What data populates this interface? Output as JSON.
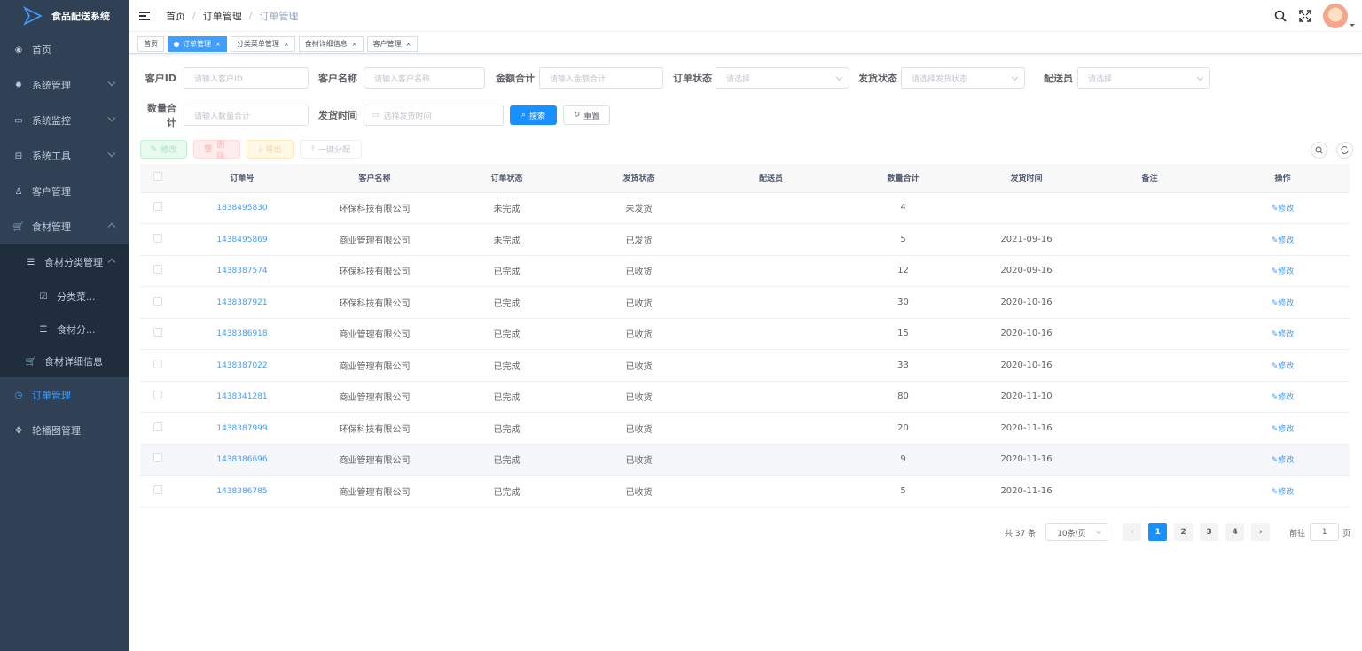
{
  "app": {
    "title": "食品配送系统"
  },
  "sidebar": {
    "items": [
      {
        "label": "首页",
        "icon": "dashboard-icon"
      },
      {
        "label": "系统管理",
        "icon": "gear-icon"
      },
      {
        "label": "系统监控",
        "icon": "monitor-icon"
      },
      {
        "label": "系统工具",
        "icon": "toolbox-icon"
      },
      {
        "label": "客户管理",
        "icon": "user-icon"
      },
      {
        "label": "食材管理",
        "icon": "cart-icon"
      },
      {
        "label": "食材分类管理",
        "icon": "list-icon"
      },
      {
        "label": "分类菜...",
        "icon": "checkbox-icon"
      },
      {
        "label": "食材分...",
        "icon": "list-icon"
      },
      {
        "label": "食材详细信息",
        "icon": "cart-icon"
      },
      {
        "label": "订单管理",
        "icon": "clock-icon"
      },
      {
        "label": "轮播图管理",
        "icon": "move-icon"
      }
    ]
  },
  "breadcrumb": [
    "首页",
    "订单管理",
    "订单管理"
  ],
  "tags": [
    {
      "label": "首页"
    },
    {
      "label": "订单管理"
    },
    {
      "label": "分类菜单管理"
    },
    {
      "label": "食材详细信息"
    },
    {
      "label": "客户管理"
    }
  ],
  "search": {
    "customer_id": {
      "label": "客户ID",
      "placeholder": "请输入客户ID"
    },
    "customer_name": {
      "label": "客户名称",
      "placeholder": "请输入客户名称"
    },
    "amount": {
      "label": "金额合计",
      "placeholder": "请输入金额合计"
    },
    "order_status": {
      "label": "订单状态",
      "placeholder": "请选择"
    },
    "ship_status": {
      "label": "发货状态",
      "placeholder": "请选择发货状态"
    },
    "courier": {
      "label": "配送员",
      "placeholder": "请选择"
    },
    "quantity": {
      "label": "数量合计",
      "placeholder": "请输入数量合计"
    },
    "ship_time": {
      "label": "发货时间",
      "placeholder": "选择发货时间"
    },
    "search_btn": "搜索",
    "reset_btn": "重置"
  },
  "toolbar": {
    "edit": "修改",
    "delete": "删除",
    "export": "导出",
    "assign": "一键分配"
  },
  "table": {
    "headers": [
      "订单号",
      "客户名称",
      "订单状态",
      "发货状态",
      "配送员",
      "数量合计",
      "发货时间",
      "备注",
      "操作"
    ],
    "rows": [
      {
        "id": "1838495830",
        "customer": "环保科技有限公司",
        "order_status": "未完成",
        "ship_status": "未发货",
        "courier": "",
        "qty": "4",
        "time": "",
        "note": "",
        "op": "修改"
      },
      {
        "id": "1438495869",
        "customer": "商业管理有限公司",
        "order_status": "未完成",
        "ship_status": "已发货",
        "courier": "",
        "qty": "5",
        "time": "2021-09-16",
        "note": "",
        "op": "修改"
      },
      {
        "id": "1438387574",
        "customer": "环保科技有限公司",
        "order_status": "已完成",
        "ship_status": "已收货",
        "courier": "",
        "qty": "12",
        "time": "2020-09-16",
        "note": "",
        "op": "修改"
      },
      {
        "id": "1438387921",
        "customer": "环保科技有限公司",
        "order_status": "已完成",
        "ship_status": "已收货",
        "courier": "",
        "qty": "30",
        "time": "2020-10-16",
        "note": "",
        "op": "修改"
      },
      {
        "id": "1438386918",
        "customer": "商业管理有限公司",
        "order_status": "已完成",
        "ship_status": "已收货",
        "courier": "",
        "qty": "15",
        "time": "2020-10-16",
        "note": "",
        "op": "修改"
      },
      {
        "id": "1438387022",
        "customer": "商业管理有限公司",
        "order_status": "已完成",
        "ship_status": "已收货",
        "courier": "",
        "qty": "33",
        "time": "2020-10-16",
        "note": "",
        "op": "修改"
      },
      {
        "id": "1438341281",
        "customer": "商业管理有限公司",
        "order_status": "已完成",
        "ship_status": "已收货",
        "courier": "",
        "qty": "80",
        "time": "2020-11-10",
        "note": "",
        "op": "修改"
      },
      {
        "id": "1438387999",
        "customer": "环保科技有限公司",
        "order_status": "已完成",
        "ship_status": "已收货",
        "courier": "",
        "qty": "20",
        "time": "2020-11-16",
        "note": "",
        "op": "修改"
      },
      {
        "id": "1438386696",
        "customer": "商业管理有限公司",
        "order_status": "已完成",
        "ship_status": "已收货",
        "courier": "",
        "qty": "9",
        "time": "2020-11-16",
        "note": "",
        "op": "修改"
      },
      {
        "id": "1438386785",
        "customer": "商业管理有限公司",
        "order_status": "已完成",
        "ship_status": "已收货",
        "courier": "",
        "qty": "5",
        "time": "2020-11-16",
        "note": "",
        "op": "修改"
      }
    ]
  },
  "pagination": {
    "total": "共 37 条",
    "page_size": "10条/页",
    "pages": [
      "1",
      "2",
      "3",
      "4"
    ],
    "current": "1",
    "goto_label": "前往",
    "goto_value": "1",
    "page_suffix": "页"
  },
  "colors": {
    "sidebar_bg": "#304156",
    "primary": "#1890ff",
    "active_menu": "#409eff"
  }
}
